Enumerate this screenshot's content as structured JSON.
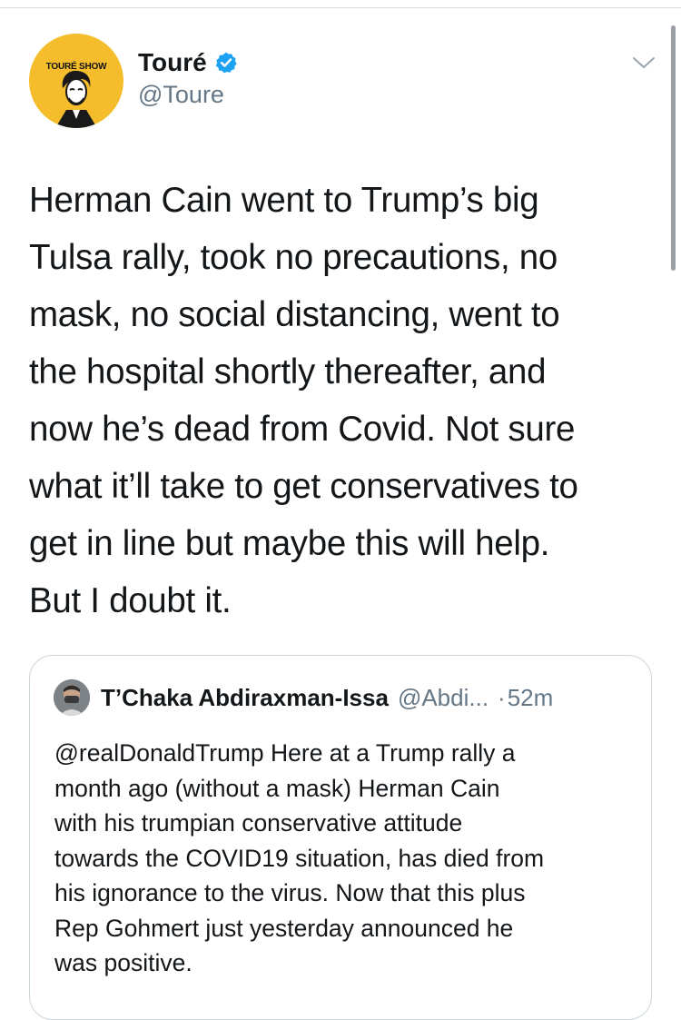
{
  "tweet": {
    "avatar_text": "TOURÉ SHOW",
    "author_name": "Touré",
    "author_handle": "@Toure",
    "verified_icon": "verified-badge-icon",
    "menu_icon": "chevron-down-icon",
    "text": "Herman Cain went to Trump’s big\nTulsa rally, took no precautions, no\nmask, no social distancing, went to\nthe hospital shortly thereafter, and\nnow he’s dead from Covid. Not sure\nwhat it’ll take to get conservatives to\nget in line but maybe this will help.\nBut I doubt it."
  },
  "quoted_tweet": {
    "author_name": "T’Chaka Abdiraxman-Issa",
    "author_handle": "@Abdi...",
    "separator": "·",
    "time": "52m",
    "text": "@realDonaldTrump Here at a Trump rally a\nmonth ago (without a mask) Herman Cain\nwith his trumpian conservative attitude\ntowards the COVID19 situation, has died from\nhis ignorance to the virus. Now that this plus\nRep Gohmert just  yesterday announced he\nwas positive."
  },
  "colors": {
    "avatar_bg": "#f5bc2b",
    "verified": "#1da1f2",
    "secondary_text": "#657786",
    "border": "#ccd6dd"
  }
}
